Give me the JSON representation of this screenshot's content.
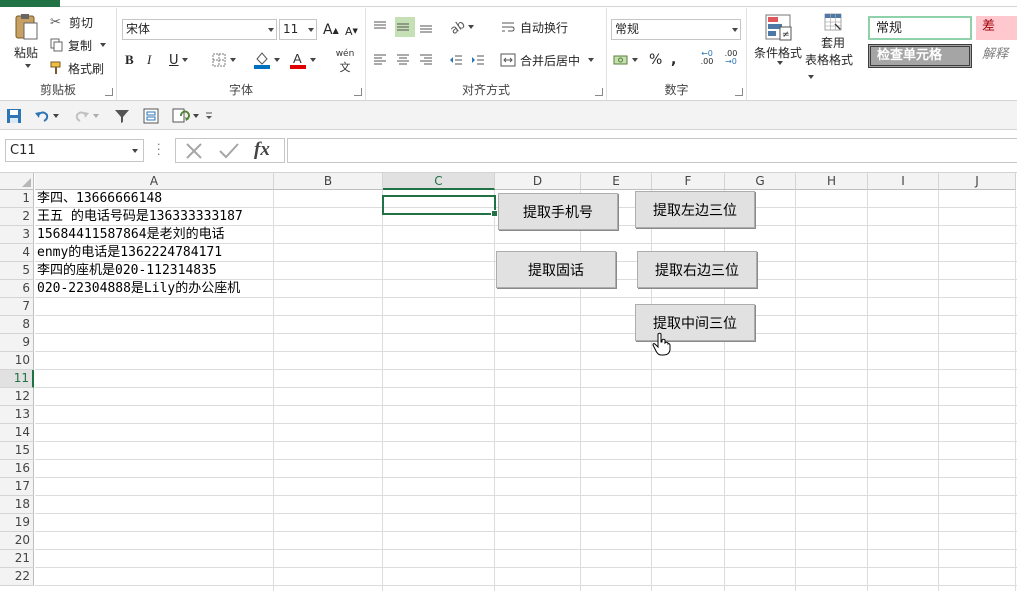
{
  "ribbon": {
    "clipboard": {
      "paste": "粘贴",
      "cut": "剪切",
      "copy": "复制",
      "format_painter": "格式刷",
      "label": "剪贴板"
    },
    "font": {
      "name": "宋体",
      "size": "11",
      "bold": "B",
      "italic": "I",
      "underline": "U",
      "grow": "A",
      "shrink": "A",
      "phonetic": "wén",
      "label": "字体"
    },
    "alignment": {
      "wrap": "自动换行",
      "merge": "合并后居中",
      "label": "对齐方式"
    },
    "number": {
      "format": "常规",
      "percent": "%",
      "comma": ",",
      "inc_decimal": ".00",
      "dec_decimal": ".00",
      "label": "数字"
    },
    "styles": {
      "conditional": "条件格式",
      "table_line1": "套用",
      "table_line2": "表格格式",
      "normal": "常规",
      "bad": "差",
      "check_cell": "检查单元格",
      "explanatory": "解释性"
    }
  },
  "formula_bar": {
    "name_box": "C11",
    "fx": "fx",
    "value": ""
  },
  "columns": [
    {
      "label": "A",
      "selected": false
    },
    {
      "label": "B",
      "selected": false
    },
    {
      "label": "C",
      "selected": true
    },
    {
      "label": "D",
      "selected": false
    },
    {
      "label": "E",
      "selected": false
    },
    {
      "label": "F",
      "selected": false
    },
    {
      "label": "G",
      "selected": false
    },
    {
      "label": "H",
      "selected": false
    },
    {
      "label": "I",
      "selected": false
    },
    {
      "label": "J",
      "selected": false
    }
  ],
  "rows": [
    "1",
    "2",
    "3",
    "4",
    "5",
    "6",
    "7",
    "8",
    "9",
    "10",
    "11",
    "12",
    "13",
    "14",
    "15",
    "16",
    "17",
    "18",
    "19",
    "20",
    "21",
    "22"
  ],
  "selected_row": "11",
  "cells": [
    "李四、13666666148",
    "王五  的电话号码是136333333187",
    "15684411587864是老刘的电话",
    "enmy的电话是1362224784171",
    "李四的座机是020-112314835",
    "020-22304888是Lily的办公座机"
  ],
  "buttons": {
    "phone": "提取手机号",
    "landline": "提取固话",
    "left3": "提取左边三位",
    "right3": "提取右边三位",
    "mid3": "提取中间三位"
  },
  "colors": {
    "accent": "#217346",
    "bad_fill": "#ffc7ce",
    "bad_text": "#9c0006",
    "check_fill": "#a5a5a5"
  }
}
